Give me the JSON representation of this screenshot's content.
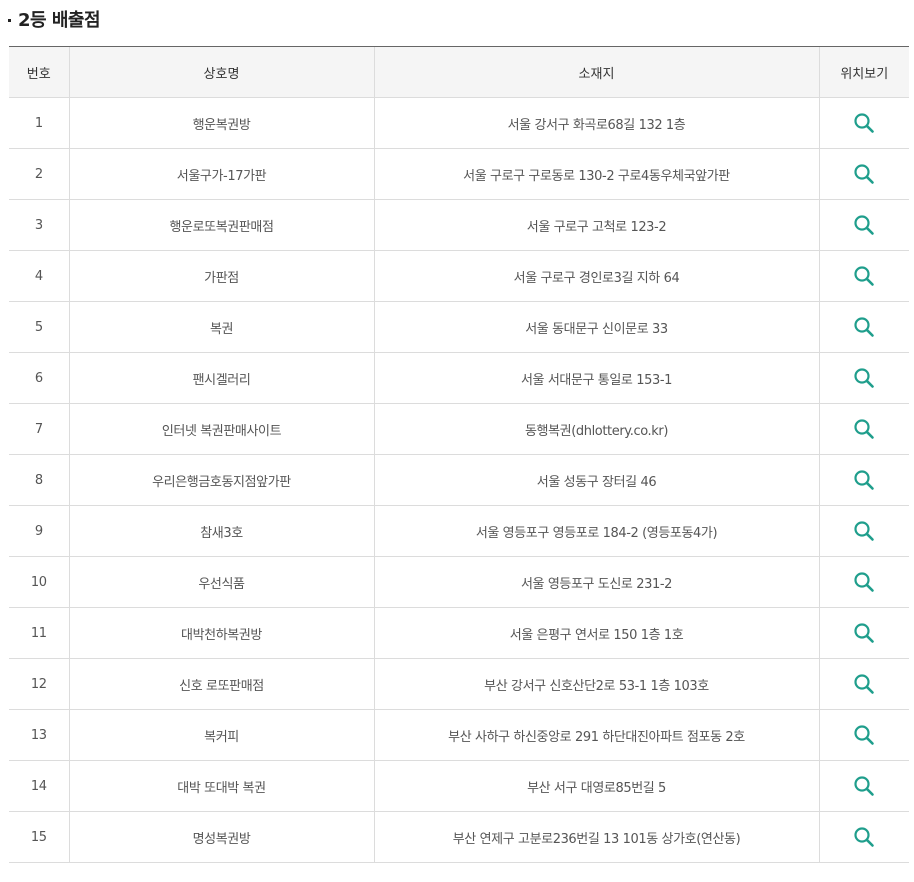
{
  "section_title": "2등 배출점",
  "columns": {
    "no": "번호",
    "name": "상호명",
    "address": "소재지",
    "map": "위치보기"
  },
  "icon": {
    "name": "search-icon",
    "color": "#1f9e8c"
  },
  "rows": [
    {
      "no": "1",
      "name": "행운복권방",
      "address": "서울 강서구 화곡로68길 132 1층"
    },
    {
      "no": "2",
      "name": "서울구가-17가판",
      "address": "서울 구로구 구로동로 130-2 구로4동우체국앞가판"
    },
    {
      "no": "3",
      "name": "행운로또복권판매점",
      "address": "서울 구로구 고척로 123-2"
    },
    {
      "no": "4",
      "name": "가판점",
      "address": "서울 구로구 경인로3길 지하 64"
    },
    {
      "no": "5",
      "name": "복권",
      "address": "서울 동대문구 신이문로 33"
    },
    {
      "no": "6",
      "name": "팬시겔러리",
      "address": "서울 서대문구 통일로 153-1"
    },
    {
      "no": "7",
      "name": "인터넷 복권판매사이트",
      "address": "동행복권(dhlottery.co.kr)"
    },
    {
      "no": "8",
      "name": "우리은행금호동지점앞가판",
      "address": "서울 성동구 장터길 46"
    },
    {
      "no": "9",
      "name": "참새3호",
      "address": "서울 영등포구 영등포로 184-2 (영등포동4가)"
    },
    {
      "no": "10",
      "name": "우선식품",
      "address": "서울 영등포구 도신로 231-2"
    },
    {
      "no": "11",
      "name": "대박천하복권방",
      "address": "서울 은평구 연서로 150 1층 1호"
    },
    {
      "no": "12",
      "name": "신호 로또판매점",
      "address": "부산 강서구 신호산단2로 53-1 1층 103호"
    },
    {
      "no": "13",
      "name": "복커피",
      "address": "부산 사하구 하신중앙로 291 하단대진아파트 점포동 2호"
    },
    {
      "no": "14",
      "name": "대박 또대박 복권",
      "address": "부산 서구 대영로85번길 5"
    },
    {
      "no": "15",
      "name": "명성복권방",
      "address": "부산 연제구 고분로236번길 13 101동 상가호(연산동)"
    }
  ]
}
